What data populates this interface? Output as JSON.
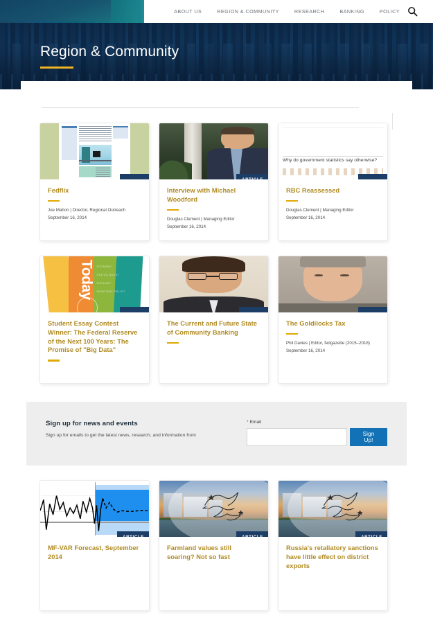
{
  "header": {
    "nav_items": [
      {
        "label": "ABOUT US",
        "name": "nav-about-us"
      },
      {
        "label": "REGION & COMMUNITY",
        "name": "nav-region-community"
      },
      {
        "label": "RESEARCH",
        "name": "nav-research"
      },
      {
        "label": "BANKING",
        "name": "nav-banking"
      },
      {
        "label": "POLICY",
        "name": "nav-policy"
      }
    ],
    "search_icon": "search-icon"
  },
  "hero": {
    "title": "Region & Community"
  },
  "cards": [
    {
      "title": "Fedflix",
      "byline": "Joe Mahon | Director, Regional Outreach",
      "date": "September 16, 2014",
      "badge": "",
      "art": "fedflix"
    },
    {
      "title": "Interview with Michael Woodford",
      "byline": "Douglas Clement | Managing Editor",
      "date": "September 16, 2014",
      "badge": "ARTICLE",
      "art": "photo-mw"
    },
    {
      "title": "RBC Reassessed",
      "byline": "Douglas Clement | Managing Editor",
      "date": "September 16, 2014",
      "badge": "",
      "art": "rbc",
      "art_caption": "Why do government statistics say otherwise?"
    },
    {
      "title": "Student Essay Contest Winner: The Federal Reserve of the Next 100 Years: The Promise of \"Big Data\"",
      "byline": "",
      "date": "",
      "badge": "",
      "art": "today",
      "art_word": "Today",
      "art_labels": [
        "ECONOMY",
        "STATUS QUEST",
        "ECOLOGY",
        "MONETARY POLICY"
      ]
    },
    {
      "title": "The Current and Future State of Community Banking",
      "byline": "",
      "date": "",
      "badge": "",
      "art": "photo-cb"
    },
    {
      "title": "The Goldilocks Tax",
      "byline": "Phil Davies | Editor, fedgazette (2015–2018)",
      "date": "September 16, 2014",
      "badge": "",
      "art": "photo-gt"
    },
    {
      "title": "MF-VAR Forecast, September 2014",
      "byline": "",
      "date": "",
      "badge": "ARTICLE",
      "art": "chart"
    },
    {
      "title": "Farmland values still soaring? Not so fast",
      "byline": "",
      "date": "",
      "badge": "ARTICLE",
      "art": "eagle"
    },
    {
      "title": "Russia's retaliatory sanctions have little effect on district exports",
      "byline": "",
      "date": "",
      "badge": "ARTICLE",
      "art": "eagle"
    }
  ],
  "signup": {
    "title": "Sign up for news and events",
    "subtitle": "Sign up for emails to get the latest news, research, and information from",
    "email_label": "Email",
    "required_mark": "*",
    "email_value": "",
    "email_placeholder": "",
    "button_label": "Sign Up!"
  },
  "colors": {
    "accent_gold": "#b08a21",
    "hero_navy": "#0c2a4d",
    "badge_navy": "#1b3d66",
    "button_blue": "#1272b5",
    "hero_rule": "#f0b323"
  }
}
